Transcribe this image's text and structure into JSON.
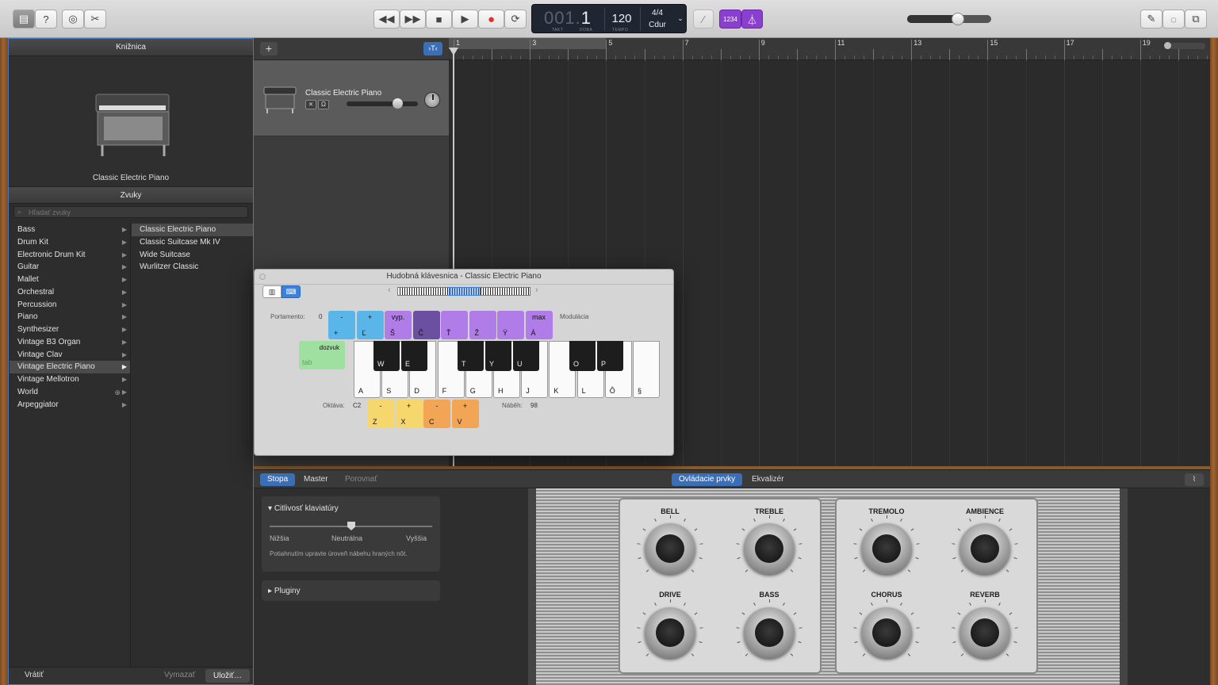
{
  "toolbar": {
    "lcd": {
      "bar": "001.",
      "beat": "1",
      "bar_label": "TAKT",
      "beat_label": "DOBA",
      "tempo": "120",
      "tempo_label": "TEMPO",
      "signature": "4/4",
      "key": "Cdur"
    },
    "count_in": "1234",
    "master_volume": 0.6
  },
  "library": {
    "title": "Knižnica",
    "instrument_name": "Classic Electric Piano",
    "sounds_title": "Zvuky",
    "search_placeholder": "Hľadať zvuky",
    "categories": [
      "Bass",
      "Drum Kit",
      "Electronic Drum Kit",
      "Guitar",
      "Mallet",
      "Orchestral",
      "Percussion",
      "Piano",
      "Synthesizer",
      "Vintage B3 Organ",
      "Vintage Clav",
      "Vintage Electric Piano",
      "Vintage Mellotron",
      "World",
      "Arpeggiator"
    ],
    "selected_category": "Vintage Electric Piano",
    "sounds": [
      "Classic Electric Piano",
      "Classic Suitcase Mk IV",
      "Wide Suitcase",
      "Wurlitzer Classic"
    ],
    "revert": "Vrátiť",
    "delete": "Vymazať",
    "save": "Uložiť…"
  },
  "track": {
    "name": "Classic Electric Piano"
  },
  "ruler": {
    "marks": [
      "1",
      "3",
      "5",
      "7",
      "9",
      "11",
      "13",
      "15",
      "17",
      "19"
    ]
  },
  "keyboard_window": {
    "title": "Hudobná klávesnica - Classic Electric Piano",
    "portamento_label": "Portamento:",
    "portamento_value": "0",
    "modulation_label": "Modulácia",
    "sustain_label": "dozvuk",
    "sustain_key": "tab",
    "octave_label": "Oktáva:",
    "octave_value": "C2",
    "velocity_label": "Náběh:",
    "velocity_value": "98",
    "pitch_keys": [
      {
        "top": "-",
        "bottom": "+",
        "color": "#5ab5e8"
      },
      {
        "top": "+",
        "bottom": "Ľ",
        "color": "#5ab5e8"
      },
      {
        "top": "vyp.",
        "bottom": "Š",
        "color": "#b07ce8"
      },
      {
        "top": "",
        "bottom": "Č",
        "color": "#6b4fa0"
      },
      {
        "top": "",
        "bottom": "Ť",
        "color": "#b07ce8"
      },
      {
        "top": "",
        "bottom": "Ž",
        "color": "#b07ce8"
      },
      {
        "top": "",
        "bottom": "Ý",
        "color": "#b07ce8"
      },
      {
        "top": "max",
        "bottom": "Á",
        "color": "#b07ce8"
      }
    ],
    "white_keys": [
      "A",
      "S",
      "D",
      "F",
      "G",
      "H",
      "J",
      "K",
      "L",
      "Ô",
      "§"
    ],
    "black_keys": [
      "W",
      "E",
      "T",
      "Y",
      "U",
      "O",
      "P"
    ],
    "octave_keys": [
      {
        "top": "-",
        "bottom": "Z",
        "color": "#f5d76e"
      },
      {
        "top": "+",
        "bottom": "X",
        "color": "#f5d76e"
      },
      {
        "top": "-",
        "bottom": "C",
        "color": "#f2a655"
      },
      {
        "top": "+",
        "bottom": "V",
        "color": "#f2a655"
      }
    ]
  },
  "editor": {
    "tabs": [
      "Stopa",
      "Master",
      "Porovnať"
    ],
    "view_tabs": [
      "Ovládacie prvky",
      "Ekvalizér"
    ],
    "sensitivity_title": "Citlivosť klaviatúry",
    "sensitivity_low": "Nižšia",
    "sensitivity_mid": "Neutrálna",
    "sensitivity_high": "Vyššia",
    "sensitivity_hint": "Potiahnutím upravte úroveň nábehu hraných nôt.",
    "plugins": "Pluginy",
    "knobs_left": [
      "BELL",
      "TREBLE",
      "DRIVE",
      "BASS"
    ],
    "knobs_right": [
      "TREMOLO",
      "AMBIENCE",
      "CHORUS",
      "REVERB"
    ]
  }
}
